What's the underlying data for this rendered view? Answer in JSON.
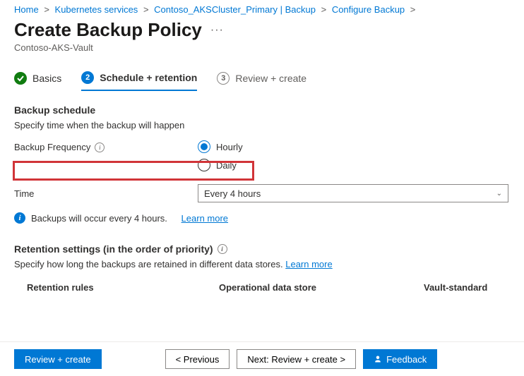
{
  "breadcrumb": {
    "items": [
      "Home",
      "Kubernetes services",
      "Contoso_AKSCluster_Primary | Backup",
      "Configure Backup"
    ]
  },
  "header": {
    "title": "Create Backup Policy",
    "subtitle": "Contoso-AKS-Vault"
  },
  "stepper": {
    "steps": [
      {
        "num": "✓",
        "label": "Basics"
      },
      {
        "num": "2",
        "label": "Schedule + retention"
      },
      {
        "num": "3",
        "label": "Review + create"
      }
    ]
  },
  "schedule": {
    "title": "Backup schedule",
    "desc": "Specify time when the backup will happen",
    "freq_label": "Backup Frequency",
    "options": {
      "hourly": "Hourly",
      "daily": "Daily"
    },
    "time_label": "Time",
    "time_value": "Every 4 hours",
    "banner": "Backups will occur every 4 hours.",
    "learn_more": "Learn more"
  },
  "retention": {
    "title": "Retention settings (in the order of priority)",
    "desc": "Specify how long the backups are retained in different data stores.",
    "learn_more": "Learn more",
    "cols": {
      "c1": "Retention rules",
      "c2": "Operational data store",
      "c3": "Vault-standard"
    }
  },
  "footer": {
    "review": "Review + create",
    "previous": "<  Previous",
    "next": "Next: Review + create  >",
    "feedback": "Feedback"
  }
}
